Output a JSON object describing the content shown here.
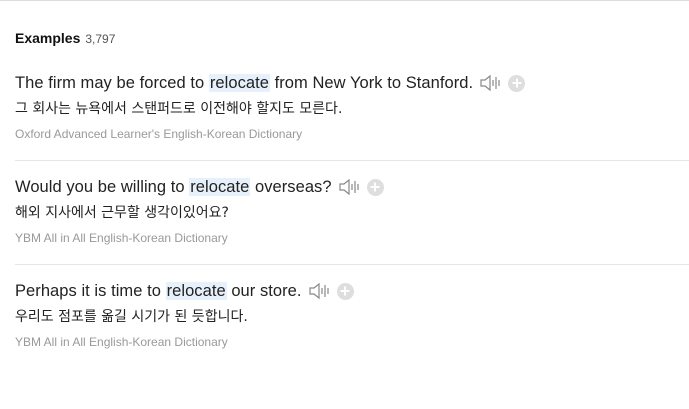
{
  "header": {
    "title": "Examples",
    "count": "3,797"
  },
  "examples": [
    {
      "before": "The firm may be forced to ",
      "keyword": "relocate",
      "after": " from New York to Stanford.",
      "translation": "그 회사는 뉴욕에서 스탠퍼드로 이전해야 할지도 모른다.",
      "source": "Oxford Advanced Learner's English-Korean Dictionary"
    },
    {
      "before": "Would you be willing to ",
      "keyword": "relocate",
      "after": " overseas?",
      "translation": "해외 지사에서 근무할 생각이있어요?",
      "source": "YBM All in All English-Korean Dictionary"
    },
    {
      "before": "Perhaps it is time to ",
      "keyword": "relocate",
      "after": " our store.",
      "translation": "우리도 점포를 옮길 시기가 된 듯합니다.",
      "source": "YBM All in All English-Korean Dictionary"
    }
  ],
  "icons": {
    "speaker": "speaker-icon",
    "add": "plus-icon"
  },
  "colors": {
    "highlight": "#e6f1fb",
    "source_text": "#999999"
  }
}
